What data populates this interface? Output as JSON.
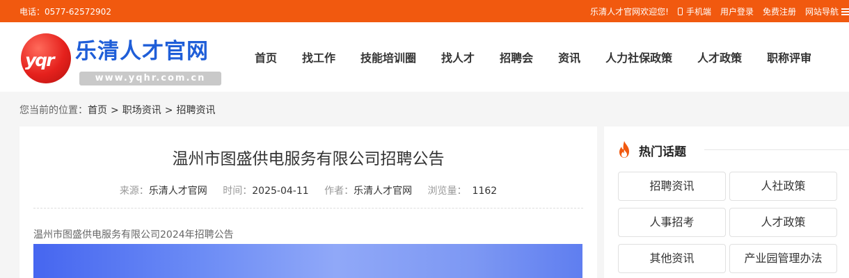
{
  "topbar": {
    "phone": "电话：0577-62572902",
    "welcome": "乐清人才官网欢迎您!",
    "mobile": "手机端",
    "login": "用户登录",
    "register": "免费注册",
    "site_nav": "网站导航"
  },
  "logo": {
    "mark": "yqr",
    "title": "乐清人才官网",
    "url": "www.yqhr.com.cn"
  },
  "nav": {
    "items": [
      "首页",
      "找工作",
      "技能培训圈",
      "找人才",
      "招聘会",
      "资讯",
      "人力社保政策",
      "人才政策",
      "职称评审"
    ]
  },
  "breadcrumb": {
    "prefix": "您当前的位置：",
    "items": [
      "首页",
      "职场资讯",
      "招聘资讯"
    ],
    "separator": ">"
  },
  "article": {
    "title": "温州市图盛供电服务有限公司招聘公告",
    "meta": {
      "source_label": "来源：",
      "source": "乐清人才官网",
      "time_label": "时间：",
      "time": "2025-04-11",
      "author_label": "作者：",
      "author": "乐清人才官网",
      "views_label": "浏览量：",
      "views": "1162"
    },
    "intro": "温州市图盛供电服务有限公司2024年招聘公告"
  },
  "sidebar": {
    "hot_title": "热门话题",
    "topics": [
      "招聘资讯",
      "人社政策",
      "人事招考",
      "人才政策",
      "其他资讯",
      "产业园管理办法"
    ]
  },
  "colors": {
    "topbar": "#f1590f",
    "brand_blue": "#1f5ed8",
    "logo_red": "#e5211d",
    "flame": "#f1590f"
  }
}
